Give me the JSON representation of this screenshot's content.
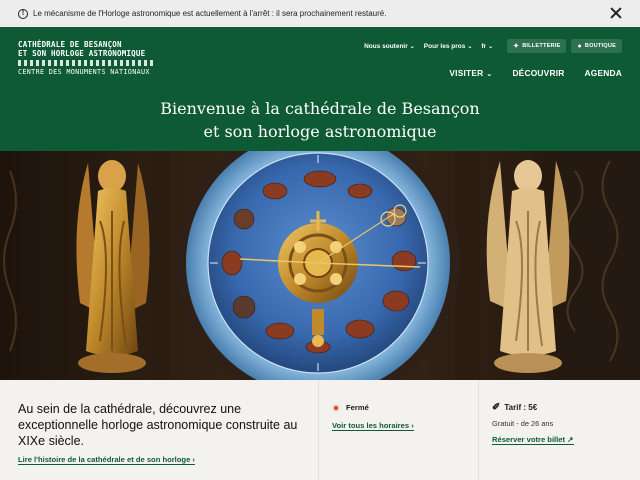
{
  "notice": {
    "text": "Le mécanisme de l'Horloge astronomique est actuellement à l'arrêt : il sera prochainement restauré.",
    "icon": "info-icon",
    "close_icon": "close-icon"
  },
  "logo": {
    "line1": "CATHÉDRALE DE BESANÇON",
    "line2": "ET SON HORLOGE ASTRONOMIQUE",
    "line3": "CENTRE DES MONUMENTS NATIONAUX"
  },
  "topnav": {
    "soutenir": "Nous soutenir",
    "pros": "Pour les pros",
    "lang": "fr",
    "billetterie": "BILLETTERIE",
    "boutique": "BOUTIQUE"
  },
  "mainnav": {
    "visiter": "VISITER",
    "decouvrir": "DÉCOUVRIR",
    "agenda": "AGENDA"
  },
  "hero": {
    "title_line1": "Bienvenue à la cathédrale de Besançon",
    "title_line2": "et son horloge astronomique"
  },
  "intro": {
    "text": "Au sein de la cathédrale, découvrez une exceptionnelle horloge astronomique construite au XIXe siècle.",
    "link": "Lire l'histoire de la cathédrale et de son horloge"
  },
  "hours": {
    "status": "Fermé",
    "link": "Voir tous les horaires"
  },
  "price": {
    "title": "Tarif : 5€",
    "sub": "Gratuit - de 26 ans",
    "link": "Réserver votre billet"
  },
  "colors": {
    "brand_green": "#0d5a34",
    "closed_red": "#d6492a",
    "dial_blue": "#3c6fb4",
    "gold": "#c9952f"
  }
}
